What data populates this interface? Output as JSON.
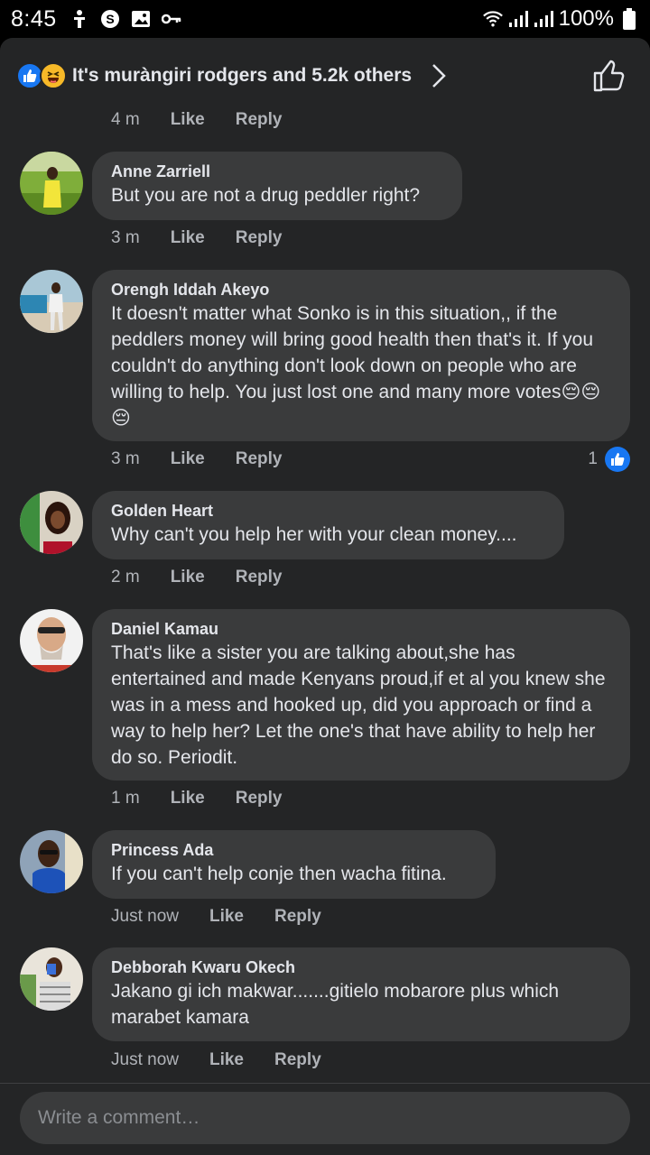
{
  "status_bar": {
    "time": "8:45",
    "battery": "100%",
    "icons_left": [
      "accessibility-icon",
      "s-app-icon",
      "gallery-icon",
      "key-icon"
    ],
    "icons_right": [
      "wifi-icon",
      "signal-icon",
      "signal-icon",
      "battery-icon"
    ]
  },
  "reactions": {
    "text": "It's muràngiri rodgers and 5.2k others",
    "icons": [
      "like-reaction-icon",
      "haha-reaction-icon"
    ]
  },
  "top_meta": {
    "time": "4 m",
    "like": "Like",
    "reply": "Reply"
  },
  "comments": [
    {
      "name": "Anne Zarriell",
      "text": "But you are not a drug peddler right?",
      "time": "3 m",
      "like": "Like",
      "reply": "Reply"
    },
    {
      "name": "Orengh Iddah Akeyo",
      "text": "It doesn't matter what Sonko is in this situation,, if the peddlers money will bring good health then that's it. If you couldn't do anything don't look down on people who are willing to help. You just lost one and many more votes😔😔😔",
      "time": "3 m",
      "like": "Like",
      "reply": "Reply",
      "like_count": "1"
    },
    {
      "name": "Golden Heart",
      "text": "Why can't you help her with your clean money....",
      "time": "2 m",
      "like": "Like",
      "reply": "Reply"
    },
    {
      "name": "Daniel Kamau",
      "text": "That's like a sister you are talking about,she has entertained and made Kenyans proud,if et al you knew she was in a mess and hooked up, did you approach or find a way to help her? Let the one's that have ability to help her do so. Periodit.",
      "time": "1 m",
      "like": "Like",
      "reply": "Reply"
    },
    {
      "name": "Princess Ada",
      "text": "If you can't help conje then wacha fitina.",
      "time": "Just now",
      "like": "Like",
      "reply": "Reply"
    },
    {
      "name": "Debborah Kwaru Okech",
      "text": "Jakano gi ich makwar.......gitielo mobarore plus which marabet kamara",
      "time": "Just now",
      "like": "Like",
      "reply": "Reply"
    }
  ],
  "composer": {
    "placeholder": "Write a comment…"
  },
  "colors": {
    "background": "#242526",
    "bubble": "#3a3b3c",
    "accent": "#1877f2",
    "muted_text": "#b0b3b8"
  }
}
